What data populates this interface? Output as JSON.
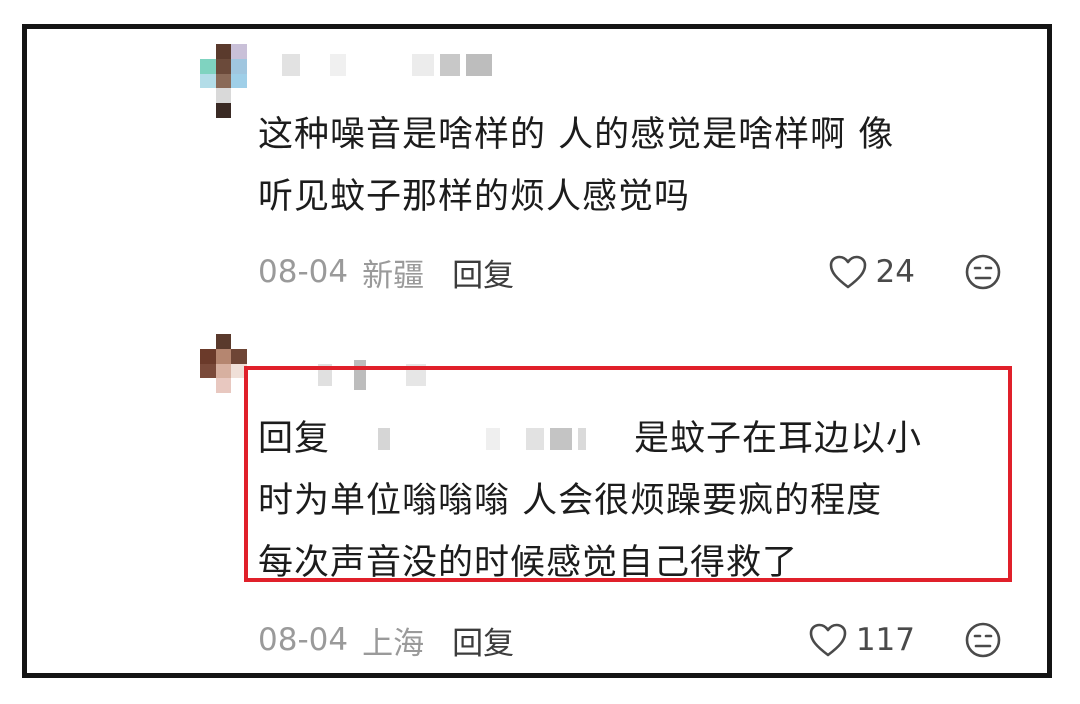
{
  "comments": [
    {
      "username": "[unclear]",
      "text_lines": [
        "这种噪音是啥样的 人的感觉是啥样啊 像",
        "听见蚊子那样的烦人感觉吗"
      ],
      "date": "08-04",
      "location": "新疆",
      "reply_label": "回复",
      "likes": "24",
      "like_icon": "heart-outline-icon",
      "dislike_icon": "meh-face-icon"
    },
    {
      "username": "[unclear]",
      "reply_prefix": "回复",
      "reply_to_user": "[unclear]",
      "text_lines": [
        "是蚊子在耳边以小",
        "时为单位嗡嗡嗡 人会很烦躁要疯的程度",
        "每次声音没的时候感觉自己得救了"
      ],
      "date": "08-04",
      "location": "上海",
      "reply_label": "回复",
      "likes": "117",
      "like_icon": "heart-outline-icon",
      "dislike_icon": "meh-face-icon",
      "highlight_color": "#e0202a"
    }
  ],
  "colors": {
    "text": "#1c1c1c",
    "meta": "#9a9a9a",
    "frame": "#141414",
    "highlight": "#e0202a"
  }
}
